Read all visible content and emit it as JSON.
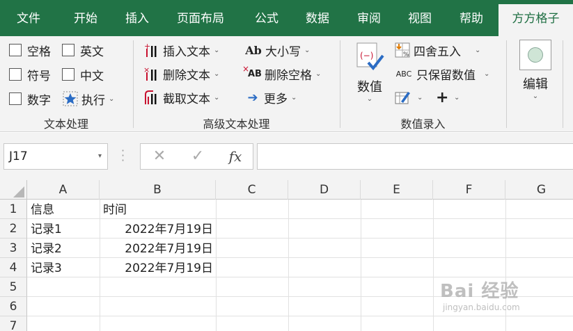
{
  "tabs": [
    {
      "label": "文件",
      "active": false
    },
    {
      "label": "开始",
      "active": false
    },
    {
      "label": "插入",
      "active": false
    },
    {
      "label": "页面布局",
      "active": false
    },
    {
      "label": "公式",
      "active": false
    },
    {
      "label": "数据",
      "active": false
    },
    {
      "label": "审阅",
      "active": false
    },
    {
      "label": "视图",
      "active": false
    },
    {
      "label": "帮助",
      "active": false
    },
    {
      "label": "方方格子",
      "active": true
    }
  ],
  "ribbon": {
    "text_group": {
      "label": "文本处理",
      "checkboxes": [
        {
          "label": "空格",
          "checked": false
        },
        {
          "label": "英文",
          "checked": false
        },
        {
          "label": "符号",
          "checked": false
        },
        {
          "label": "中文",
          "checked": false
        },
        {
          "label": "数字",
          "checked": false
        }
      ],
      "execute_label": "执行"
    },
    "advanced_group": {
      "label": "高级文本处理",
      "insert_text": "插入文本",
      "delete_text": "删除文本",
      "extract_text": "截取文本",
      "case_label": "大小写",
      "case_icon_text": "Ab",
      "delete_spaces": "删除空格",
      "delete_spaces_icon_text": "AB",
      "more_label": "更多"
    },
    "numeric_group": {
      "label": "数值录入",
      "value_button": "数值",
      "round_label": "四舍五入",
      "keep_values_label": "只保留数值",
      "keep_values_icon_text": "ABC",
      "plus_label": "+"
    },
    "edit_group": {
      "edit_button": "编辑"
    }
  },
  "formula_bar": {
    "name_box": "J17",
    "cancel_symbol": "✕",
    "enter_symbol": "✓",
    "fx_label": "fx",
    "formula": ""
  },
  "sheet": {
    "columns": [
      "A",
      "B",
      "C",
      "D",
      "E",
      "F",
      "G"
    ],
    "rows": [
      "1",
      "2",
      "3",
      "4",
      "5",
      "6",
      "7"
    ],
    "cells": [
      {
        "a": "信息",
        "b": "时间"
      },
      {
        "a": "记录1",
        "b": "2022年7月19日"
      },
      {
        "a": "记录2",
        "b": "2022年7月19日"
      },
      {
        "a": "记录3",
        "b": "2022年7月19日"
      }
    ]
  },
  "watermark": {
    "main": "Bai 经验",
    "sub": "jingyan.baidu.com"
  },
  "colors": {
    "excel_green": "#217346",
    "ribbon_bg": "#f3f3f3",
    "active_tab_text": "#1f6f43",
    "accent_blue": "#2b6cc4",
    "accent_red": "#c8102e"
  }
}
